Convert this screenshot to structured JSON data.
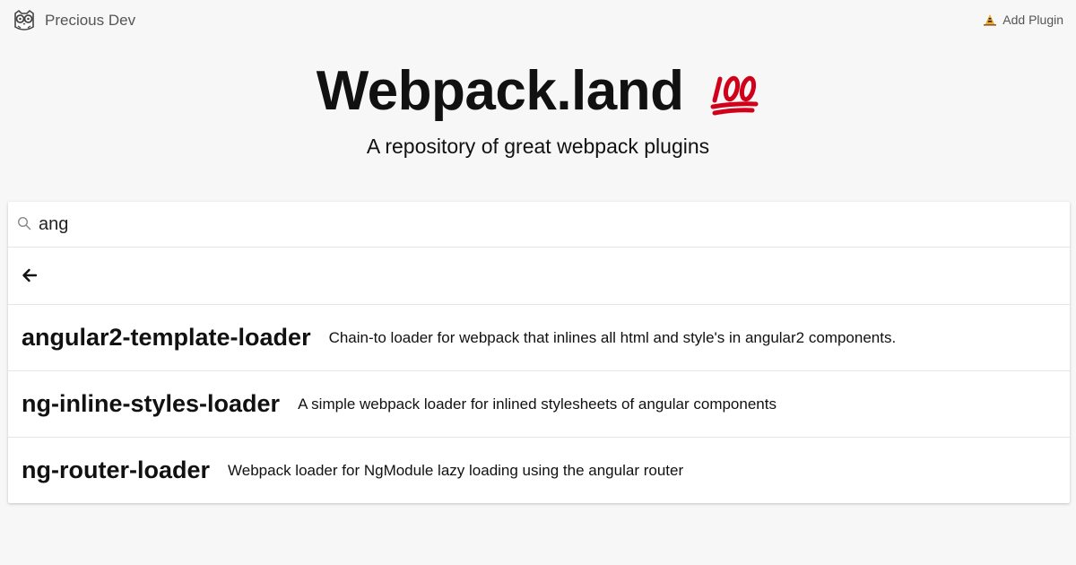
{
  "header": {
    "brand_name": "Precious Dev",
    "brand_icon": "owl-glasses-icon",
    "add_plugin_label": "Add Plugin",
    "add_plugin_icon": "construction-icon"
  },
  "hero": {
    "title": "Webpack.land",
    "title_emoji": "100-emoji-icon",
    "subtitle": "A repository of great webpack plugins"
  },
  "search": {
    "value": "ang",
    "icon": "search-icon"
  },
  "back": {
    "icon": "arrow-left-icon"
  },
  "results": [
    {
      "name": "angular2-template-loader",
      "description": "Chain-to loader for webpack that inlines all html and style's in angular2 components."
    },
    {
      "name": "ng-inline-styles-loader",
      "description": "A simple webpack loader for inlined stylesheets of angular components"
    },
    {
      "name": "ng-router-loader",
      "description": "Webpack loader for NgModule lazy loading using the angular router"
    }
  ],
  "colors": {
    "background": "#f7f7f7",
    "panel": "#ffffff",
    "emoji_red": "#d0021b"
  }
}
